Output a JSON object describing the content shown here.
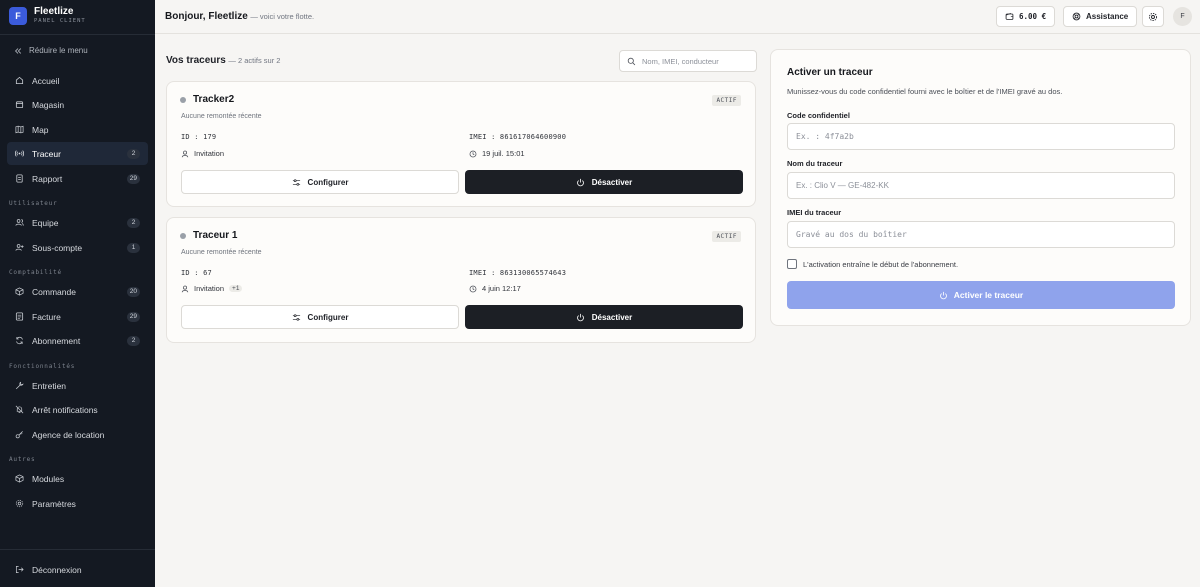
{
  "brand": {
    "logo_letter": "F",
    "name": "Fleetlize",
    "subtitle": "PANEL CLIENT"
  },
  "sidebar": {
    "collapse_label": "Réduire le menu",
    "main_items": [
      {
        "label": "Accueil",
        "icon": "home-icon"
      },
      {
        "label": "Magasin",
        "icon": "store-icon"
      },
      {
        "label": "Map",
        "icon": "map-icon"
      },
      {
        "label": "Traceur",
        "icon": "radio-icon",
        "badge": "2",
        "active": true
      },
      {
        "label": "Rapport",
        "icon": "report-icon",
        "badge": "29"
      }
    ],
    "sections": [
      {
        "title": "Utilisateur",
        "items": [
          {
            "label": "Equipe",
            "icon": "users-icon",
            "badge": "2"
          },
          {
            "label": "Sous-compte",
            "icon": "user-plus-icon",
            "badge": "1"
          }
        ]
      },
      {
        "title": "Comptabilité",
        "items": [
          {
            "label": "Commande",
            "icon": "package-icon",
            "badge": "20"
          },
          {
            "label": "Facture",
            "icon": "invoice-icon",
            "badge": "29"
          },
          {
            "label": "Abonnement",
            "icon": "refresh-icon",
            "badge": "2"
          }
        ]
      },
      {
        "title": "Fonctionnalités",
        "items": [
          {
            "label": "Entretien",
            "icon": "wrench-icon"
          },
          {
            "label": "Arrêt notifications",
            "icon": "bell-off-icon"
          },
          {
            "label": "Agence de location",
            "icon": "key-icon"
          }
        ]
      },
      {
        "title": "Autres",
        "items": [
          {
            "label": "Modules",
            "icon": "boxes-icon"
          },
          {
            "label": "Paramètres",
            "icon": "settings-icon"
          }
        ]
      }
    ],
    "logout_label": "Déconnexion"
  },
  "topbar": {
    "greeting": "Bonjour, Fleetlize",
    "greeting_sub": "— voici votre flotte.",
    "wallet": "6.00 €",
    "assistance": "Assistance",
    "avatar_letter": "F"
  },
  "trackers": {
    "title": "Vos traceurs",
    "count": "— 2 actifs sur 2",
    "search_placeholder": "Nom, IMEI, conducteur",
    "configure_label": "Configurer",
    "deactivate_label": "Désactiver",
    "items": [
      {
        "name": "Tracker2",
        "status": "ACTIF",
        "last_report": "Aucune remontée récente",
        "id": "ID : 179",
        "imei": "IMEI : 861617064600900",
        "driver": "Invitation",
        "extra": "",
        "date": "19 juil. 15:01"
      },
      {
        "name": "Traceur 1",
        "status": "ACTIF",
        "last_report": "Aucune remontée récente",
        "id": "ID : 67",
        "imei": "IMEI : 863130065574643",
        "driver": "Invitation",
        "extra": "+1",
        "date": "4 juin 12:17"
      }
    ]
  },
  "activation": {
    "title": "Activer un traceur",
    "subtitle": "Munissez-vous du code confidentiel fourni avec le boîtier et de l'IMEI gravé au dos.",
    "code_label": "Code confidentiel",
    "code_placeholder": "Ex. : 4f7a2b",
    "name_label": "Nom du traceur",
    "name_placeholder": "Ex. : Clio V — GE-482-KK",
    "imei_label": "IMEI du traceur",
    "imei_placeholder": "Gravé au dos du boîtier",
    "checkbox_label": "L'activation entraîne le début de l'abonnement.",
    "submit_label": "Activer le traceur"
  },
  "colors": {
    "sidebar_bg": "#141922",
    "accent": "#3b5bdb",
    "activate_button": "#8fa3ec",
    "dark_button": "#1c1f25"
  }
}
